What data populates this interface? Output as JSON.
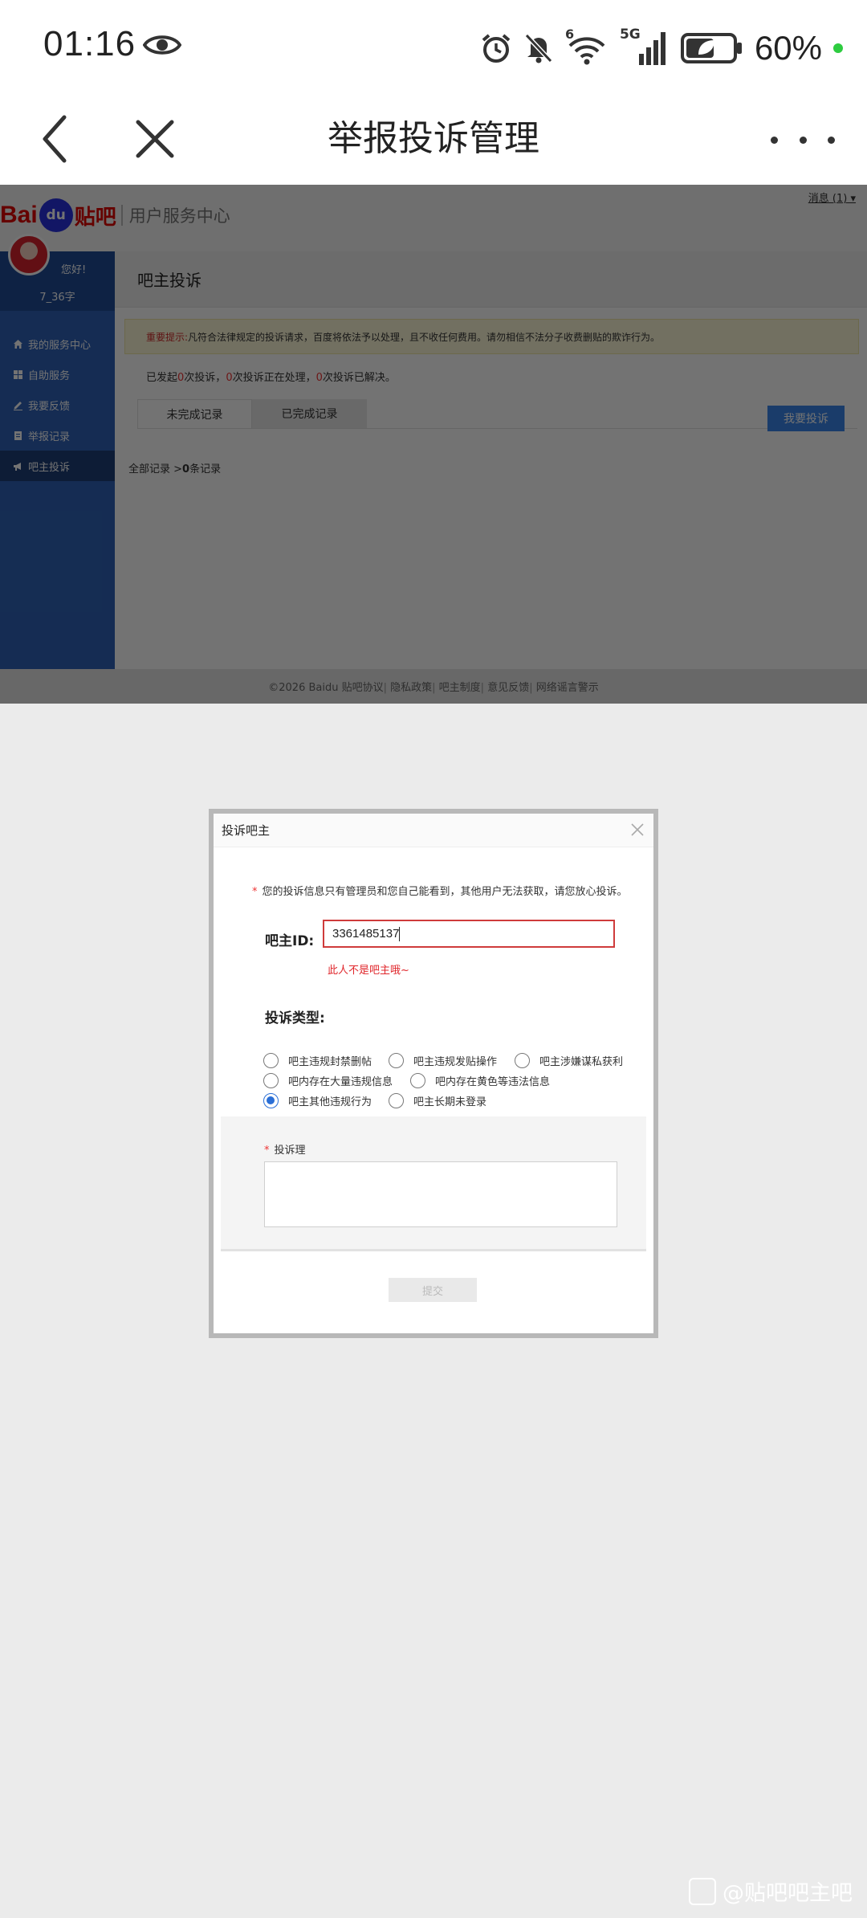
{
  "status_bar": {
    "time": "01:16",
    "network_label": "5G",
    "wifi_label": "6",
    "battery_percent": "60%",
    "battery_level": 0.6
  },
  "nav": {
    "title": "举报投诉管理"
  },
  "web": {
    "logo_bai": "Bai",
    "logo_du": "du",
    "logo_tieba": "贴吧",
    "logo_subtitle": "用户服务中心",
    "messages_link": "消息 (1) ▾",
    "user": {
      "greeting": "您好!",
      "name": "7_36字"
    },
    "sidebar_items": [
      {
        "label": "我的服务中心",
        "icon": "home-icon"
      },
      {
        "label": "自助服务",
        "icon": "grid-icon"
      },
      {
        "label": "我要反馈",
        "icon": "pencil-icon"
      },
      {
        "label": "举报记录",
        "icon": "record-icon"
      },
      {
        "label": "吧主投诉",
        "icon": "megaphone-icon"
      }
    ],
    "content_title": "吧主投诉",
    "notice_key": "重要提示:",
    "notice_text": "凡符合法律规定的投诉请求，百度将依法予以处理，且不收任何费用。请勿相信不法分子收费删贴的欺诈行为。",
    "stats": {
      "p1": "已发起",
      "n1": "0",
      "p2": "次投诉，",
      "n2": "0",
      "p3": "次投诉正在处理，",
      "n3": "0",
      "p4": "次投诉已解决。"
    },
    "tabs": [
      "未完成记录",
      "已完成记录"
    ],
    "report_button": "我要投诉",
    "breadcrumb_prefix": "全部记录 >",
    "breadcrumb_count": "0",
    "breadcrumb_suffix": "条记录",
    "footer_links": [
      "©2026 Baidu 贴吧协议",
      "隐私政策",
      "吧主制度",
      "意见反馈",
      "网络谣言警示"
    ]
  },
  "modal": {
    "title": "投诉吧主",
    "privacy_note": "您的投诉信息只有管理员和您自己能看到，其他用户无法获取，请您放心投诉。",
    "id_label": "吧主ID:",
    "id_value": "3361485137",
    "id_error": "此人不是吧主哦~",
    "type_label": "投诉类型:",
    "types": [
      {
        "label": "吧主违规封禁删帖",
        "checked": false
      },
      {
        "label": "吧主违规发贴操作",
        "checked": false
      },
      {
        "label": "吧主涉嫌谋私获利",
        "checked": false
      },
      {
        "label": "吧内存在大量违规信息",
        "checked": false
      },
      {
        "label": "吧内存在黄色等违法信息",
        "checked": false
      },
      {
        "label": "吧主其他违规行为",
        "checked": true
      },
      {
        "label": "吧主长期未登录",
        "checked": false
      }
    ],
    "reason_label": "投诉理",
    "reason_value": "",
    "submit_label": "提交"
  },
  "watermark": "@贴吧吧主吧",
  "colors": {
    "sidebar_blue": "#2f63b9",
    "brand_red": "#e10601",
    "button_blue": "#3a86ea",
    "error_red": "#e0262b"
  }
}
